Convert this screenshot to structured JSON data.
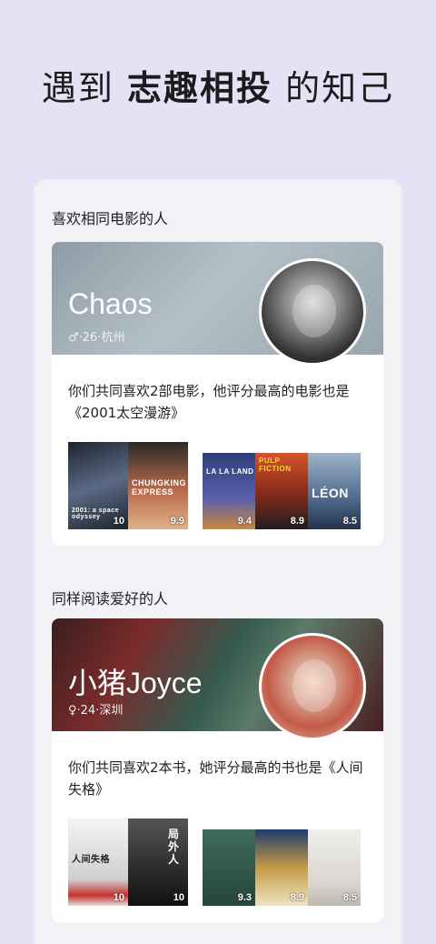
{
  "headline": {
    "prefix": "遇到 ",
    "highlight": "志趣相投",
    "suffix": " 的知己"
  },
  "sections": [
    {
      "title": "喜欢相同电影的人",
      "user": {
        "name": "Chaos",
        "meta": "♂·26·杭州"
      },
      "description": "你们共同喜欢2部电影，他评分最高的电影也是《2001太空漫游》",
      "shared": [
        {
          "title": "2001: a space odyssey",
          "score": "10",
          "color": "#2b3a55"
        },
        {
          "title": "CHUNGKING EXPRESS",
          "score": "9.9",
          "color": "#b86a4a"
        }
      ],
      "others": [
        {
          "title": "LA LA LAND",
          "score": "9.4",
          "color": "#2d3f7c"
        },
        {
          "title": "PULP FICTION",
          "score": "8.9",
          "color": "#b2451f"
        },
        {
          "title": "LÉON",
          "score": "8.5",
          "color": "#4e6a8e"
        }
      ]
    },
    {
      "title": "同样阅读爱好的人",
      "user": {
        "name": "小猪Joyce",
        "meta": "♀·24·深圳"
      },
      "description": "你们共同喜欢2本书，她评分最高的书也是《人间失格》",
      "shared": [
        {
          "title": "人间失格",
          "score": "10",
          "color": "#d8d8d8"
        },
        {
          "title": "局外人",
          "score": "10",
          "color": "#3a3a3a"
        }
      ],
      "others": [
        {
          "title": "",
          "score": "9.3",
          "color": "#3f6b5c"
        },
        {
          "title": "",
          "score": "8.9",
          "color": "#c39c45"
        },
        {
          "title": "",
          "score": "8.5",
          "color": "#e8e6e2"
        }
      ]
    }
  ]
}
